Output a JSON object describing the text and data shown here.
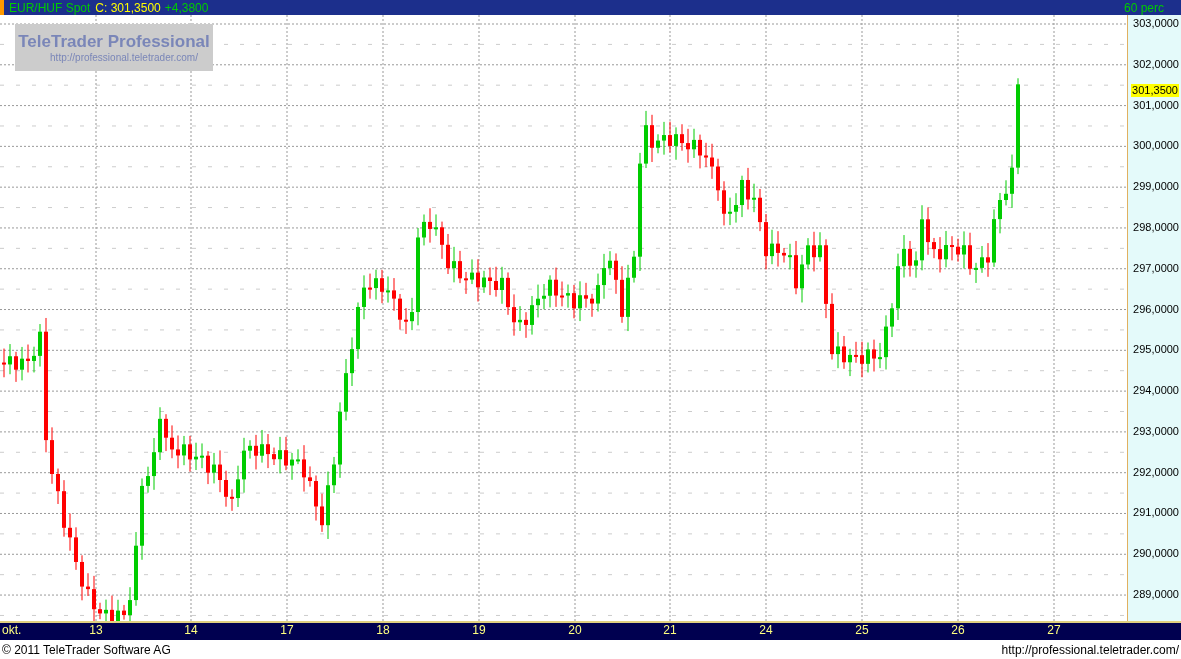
{
  "header": {
    "symbol": "EUR/HUF Spot",
    "close": "C: 301,3500",
    "change": "+4,3800",
    "interval": "60 perc"
  },
  "logo": {
    "title": "TeleTrader Professional",
    "url": "http://professional.teletrader.com/"
  },
  "y_axis_labels": [
    "303,0000",
    "302,0000",
    "301,0000",
    "300,0000",
    "299,0000",
    "298,0000",
    "297,0000",
    "296,0000",
    "295,0000",
    "294,0000",
    "293,0000",
    "292,0000",
    "291,0000",
    "290,0000",
    "289,0000"
  ],
  "price_marker": "301,3500",
  "x_axis_labels": [
    "okt.",
    "13",
    "14",
    "17",
    "18",
    "19",
    "20",
    "21",
    "24",
    "25",
    "26",
    "27"
  ],
  "footer": {
    "copyright": "© 2011 TeleTrader Software AG",
    "url": "http://professional.teletrader.com/"
  }
}
